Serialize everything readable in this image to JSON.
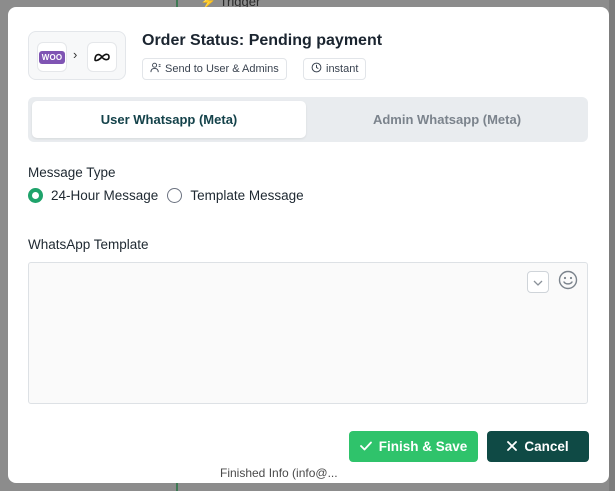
{
  "background": {
    "trigger_label": "Trigger",
    "bottom_text": "Finished Info (info@..."
  },
  "modal": {
    "integration": {
      "source_app": "WOO",
      "source_icon": "woocommerce-icon",
      "target_icon": "meta-icon"
    },
    "title": "Order Status: Pending payment",
    "badges": {
      "audience": "Send to User & Admins",
      "timing": "instant"
    },
    "tabs": [
      {
        "label": "User Whatsapp (Meta)",
        "active": true
      },
      {
        "label": "Admin Whatsapp (Meta)",
        "active": false
      }
    ],
    "message_type": {
      "label": "Message Type",
      "options": [
        {
          "label": "24-Hour Message",
          "checked": true
        },
        {
          "label": "Template Message",
          "checked": false
        }
      ]
    },
    "template": {
      "label": "WhatsApp Template",
      "value": ""
    },
    "actions": {
      "finish_label": "Finish & Save",
      "cancel_label": "Cancel"
    }
  },
  "colors": {
    "accent_green": "#2fc36b",
    "dark_teal": "#0f4a45",
    "radio_green": "#1fa36b",
    "woo_purple": "#7f54b3"
  }
}
